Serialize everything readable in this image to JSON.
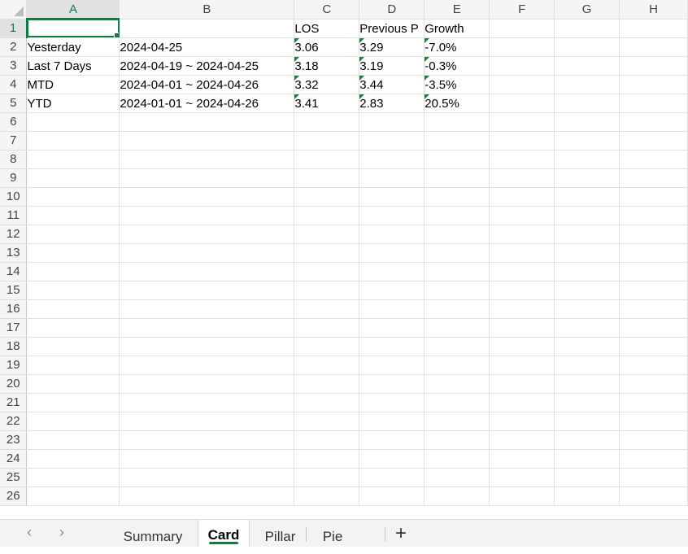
{
  "columns": [
    "A",
    "B",
    "C",
    "D",
    "E",
    "F",
    "G",
    "H"
  ],
  "active_column": "A",
  "active_row": "1",
  "rows": [
    {
      "n": "1",
      "cells": [
        "",
        "",
        "LOS",
        "Previous P",
        "Growth",
        "",
        "",
        ""
      ]
    },
    {
      "n": "2",
      "cells": [
        "Yesterday",
        "2024-04-25",
        "3.06",
        "3.29",
        "-7.0%",
        "",
        "",
        ""
      ]
    },
    {
      "n": "3",
      "cells": [
        "Last 7 Days",
        "2024-04-19 ~ 2024-04-25",
        "3.18",
        "3.19",
        "-0.3%",
        "",
        "",
        ""
      ]
    },
    {
      "n": "4",
      "cells": [
        "MTD",
        "2024-04-01 ~ 2024-04-26",
        "3.32",
        "3.44",
        "-3.5%",
        "",
        "",
        ""
      ]
    },
    {
      "n": "5",
      "cells": [
        "YTD",
        "2024-01-01 ~ 2024-04-26",
        "3.41",
        "2.83",
        "20.5%",
        "",
        "",
        ""
      ]
    },
    {
      "n": "6",
      "cells": [
        "",
        "",
        "",
        "",
        "",
        "",
        "",
        ""
      ]
    },
    {
      "n": "7",
      "cells": [
        "",
        "",
        "",
        "",
        "",
        "",
        "",
        ""
      ]
    },
    {
      "n": "8",
      "cells": [
        "",
        "",
        "",
        "",
        "",
        "",
        "",
        ""
      ]
    },
    {
      "n": "9",
      "cells": [
        "",
        "",
        "",
        "",
        "",
        "",
        "",
        ""
      ]
    },
    {
      "n": "10",
      "cells": [
        "",
        "",
        "",
        "",
        "",
        "",
        "",
        ""
      ]
    },
    {
      "n": "11",
      "cells": [
        "",
        "",
        "",
        "",
        "",
        "",
        "",
        ""
      ]
    },
    {
      "n": "12",
      "cells": [
        "",
        "",
        "",
        "",
        "",
        "",
        "",
        ""
      ]
    },
    {
      "n": "13",
      "cells": [
        "",
        "",
        "",
        "",
        "",
        "",
        "",
        ""
      ]
    },
    {
      "n": "14",
      "cells": [
        "",
        "",
        "",
        "",
        "",
        "",
        "",
        ""
      ]
    },
    {
      "n": "15",
      "cells": [
        "",
        "",
        "",
        "",
        "",
        "",
        "",
        ""
      ]
    },
    {
      "n": "16",
      "cells": [
        "",
        "",
        "",
        "",
        "",
        "",
        "",
        ""
      ]
    },
    {
      "n": "17",
      "cells": [
        "",
        "",
        "",
        "",
        "",
        "",
        "",
        ""
      ]
    },
    {
      "n": "18",
      "cells": [
        "",
        "",
        "",
        "",
        "",
        "",
        "",
        ""
      ]
    },
    {
      "n": "19",
      "cells": [
        "",
        "",
        "",
        "",
        "",
        "",
        "",
        ""
      ]
    },
    {
      "n": "20",
      "cells": [
        "",
        "",
        "",
        "",
        "",
        "",
        "",
        ""
      ]
    },
    {
      "n": "21",
      "cells": [
        "",
        "",
        "",
        "",
        "",
        "",
        "",
        ""
      ]
    },
    {
      "n": "22",
      "cells": [
        "",
        "",
        "",
        "",
        "",
        "",
        "",
        ""
      ]
    },
    {
      "n": "23",
      "cells": [
        "",
        "",
        "",
        "",
        "",
        "",
        "",
        ""
      ]
    },
    {
      "n": "24",
      "cells": [
        "",
        "",
        "",
        "",
        "",
        "",
        "",
        ""
      ]
    },
    {
      "n": "25",
      "cells": [
        "",
        "",
        "",
        "",
        "",
        "",
        "",
        ""
      ]
    },
    {
      "n": "26",
      "cells": [
        "",
        "",
        "",
        "",
        "",
        "",
        "",
        ""
      ]
    }
  ],
  "sheet_tabs": {
    "prev_icon": "chevron-left-icon",
    "next_icon": "chevron-right-icon",
    "tabs": [
      {
        "label": "Summary",
        "active": false
      },
      {
        "label": "Card",
        "active": true
      },
      {
        "label": "Pillar",
        "active": false
      },
      {
        "label": "Pie",
        "active": false
      }
    ],
    "add_label": "+"
  },
  "colors": {
    "accent": "#107c41",
    "error_triangle": "#1e7e34",
    "header_bg": "#f5f5f5",
    "gridline": "#e1e1e1"
  }
}
